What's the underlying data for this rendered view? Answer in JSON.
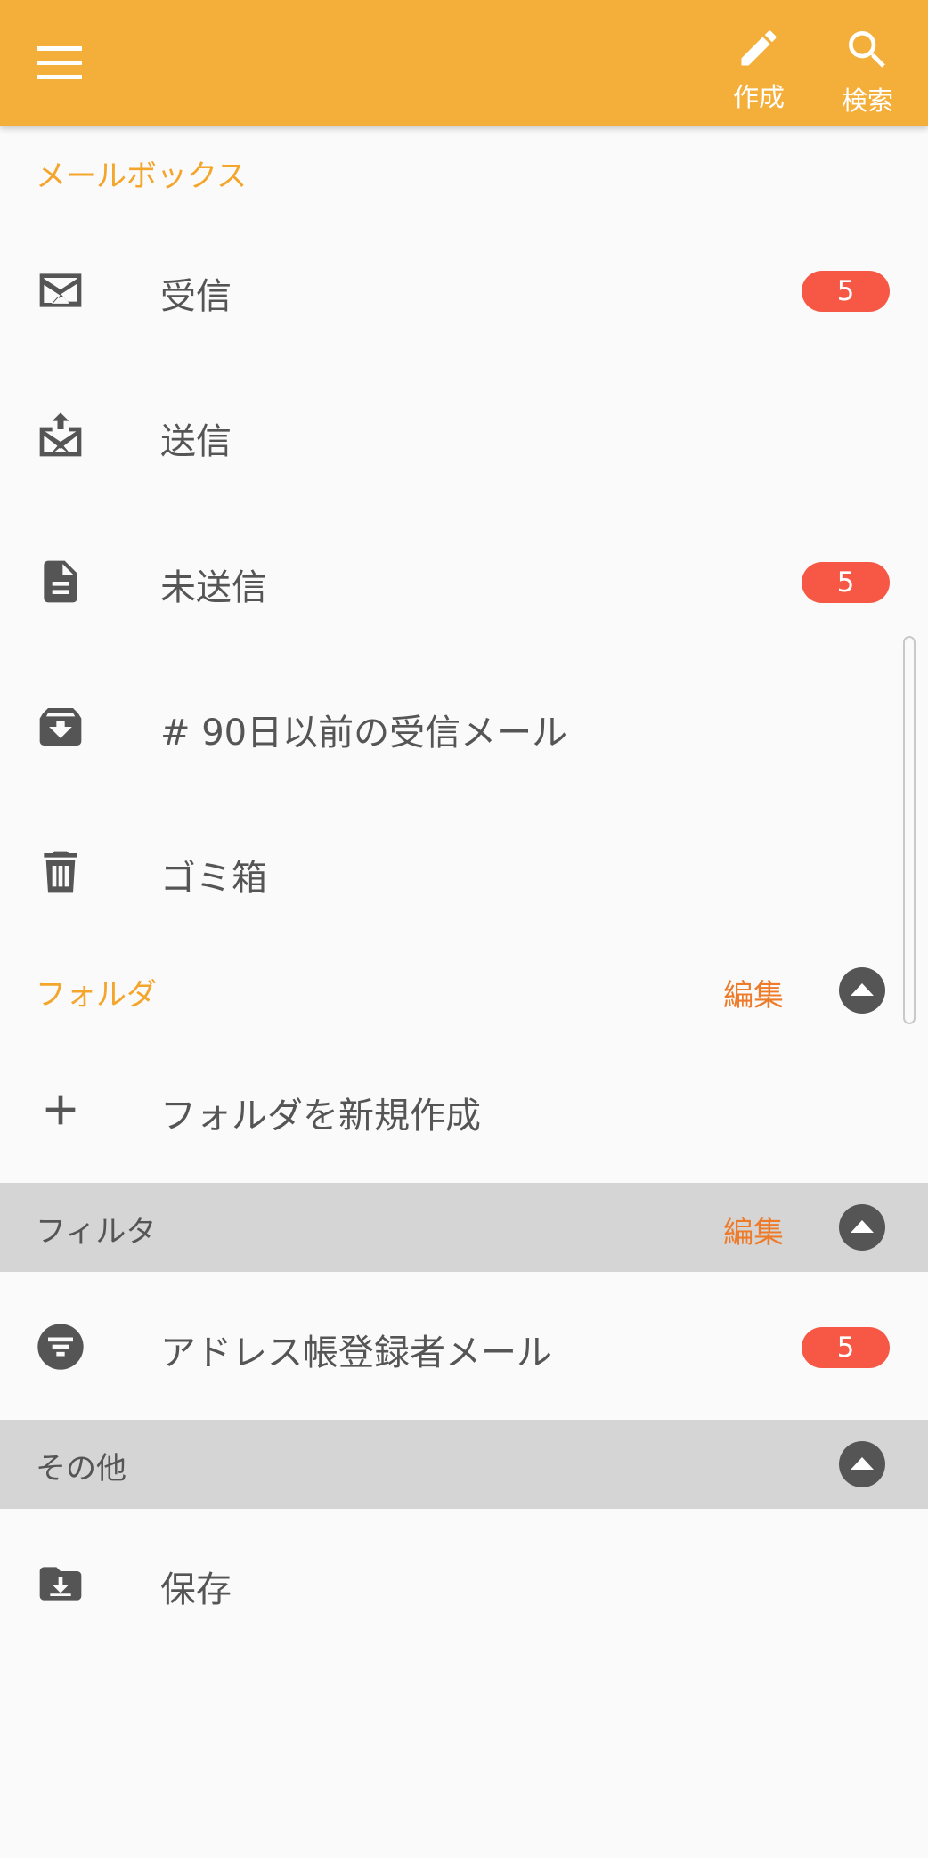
{
  "appbar": {
    "color": "#f4af3b",
    "menu_icon": "hamburger-menu-icon",
    "compose_label": "作成",
    "search_label": "検索"
  },
  "mailbox": {
    "title": "メールボックス",
    "items": [
      {
        "label": "受信",
        "icon": "mail-envelope-icon",
        "badge": "5"
      },
      {
        "label": "送信",
        "icon": "mail-upload-icon"
      },
      {
        "label": "未送信",
        "icon": "document-icon",
        "badge": "5"
      },
      {
        "label": "# 90日以前の受信メール",
        "icon": "archive-tray-icon"
      },
      {
        "label": "ゴミ箱",
        "icon": "trash-icon"
      }
    ]
  },
  "folder": {
    "title": "フォルダ",
    "edit_label": "編集",
    "items": [
      {
        "label": "フォルダを新規作成",
        "icon": "plus-icon"
      }
    ]
  },
  "filter": {
    "title": "フィルタ",
    "edit_label": "編集",
    "items": [
      {
        "label": "アドレス帳登録者メール",
        "icon": "filter-icon",
        "badge": "5"
      }
    ]
  },
  "other": {
    "title": "その他",
    "items": [
      {
        "label": "保存",
        "icon": "save-download-icon"
      }
    ]
  },
  "colors": {
    "accent": "#f4a52c",
    "edit": "#ed7b2a",
    "badge": "#f65845",
    "icon": "#555555",
    "section_bg": "#d5d5d5"
  }
}
